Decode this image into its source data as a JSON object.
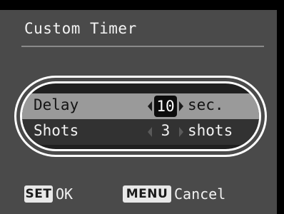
{
  "screen": {
    "title": "Custom Timer"
  },
  "settings": {
    "rows": [
      {
        "label": "Delay",
        "value": "10",
        "unit": "sec.",
        "selected": true
      },
      {
        "label": "Shots",
        "value": "3",
        "unit": "shots",
        "selected": false
      }
    ]
  },
  "footer": {
    "set_badge": "SET",
    "set_action": "OK",
    "menu_badge": "MENU",
    "menu_action": "Cancel"
  },
  "colors": {
    "background": "#4a4a4a",
    "selected_row": "#9a9a9a",
    "normal_row": "#323232",
    "highlight_ring": "#ffffff"
  },
  "icons": {
    "decrease": "triangle-left-icon",
    "increase": "triangle-right-icon"
  }
}
